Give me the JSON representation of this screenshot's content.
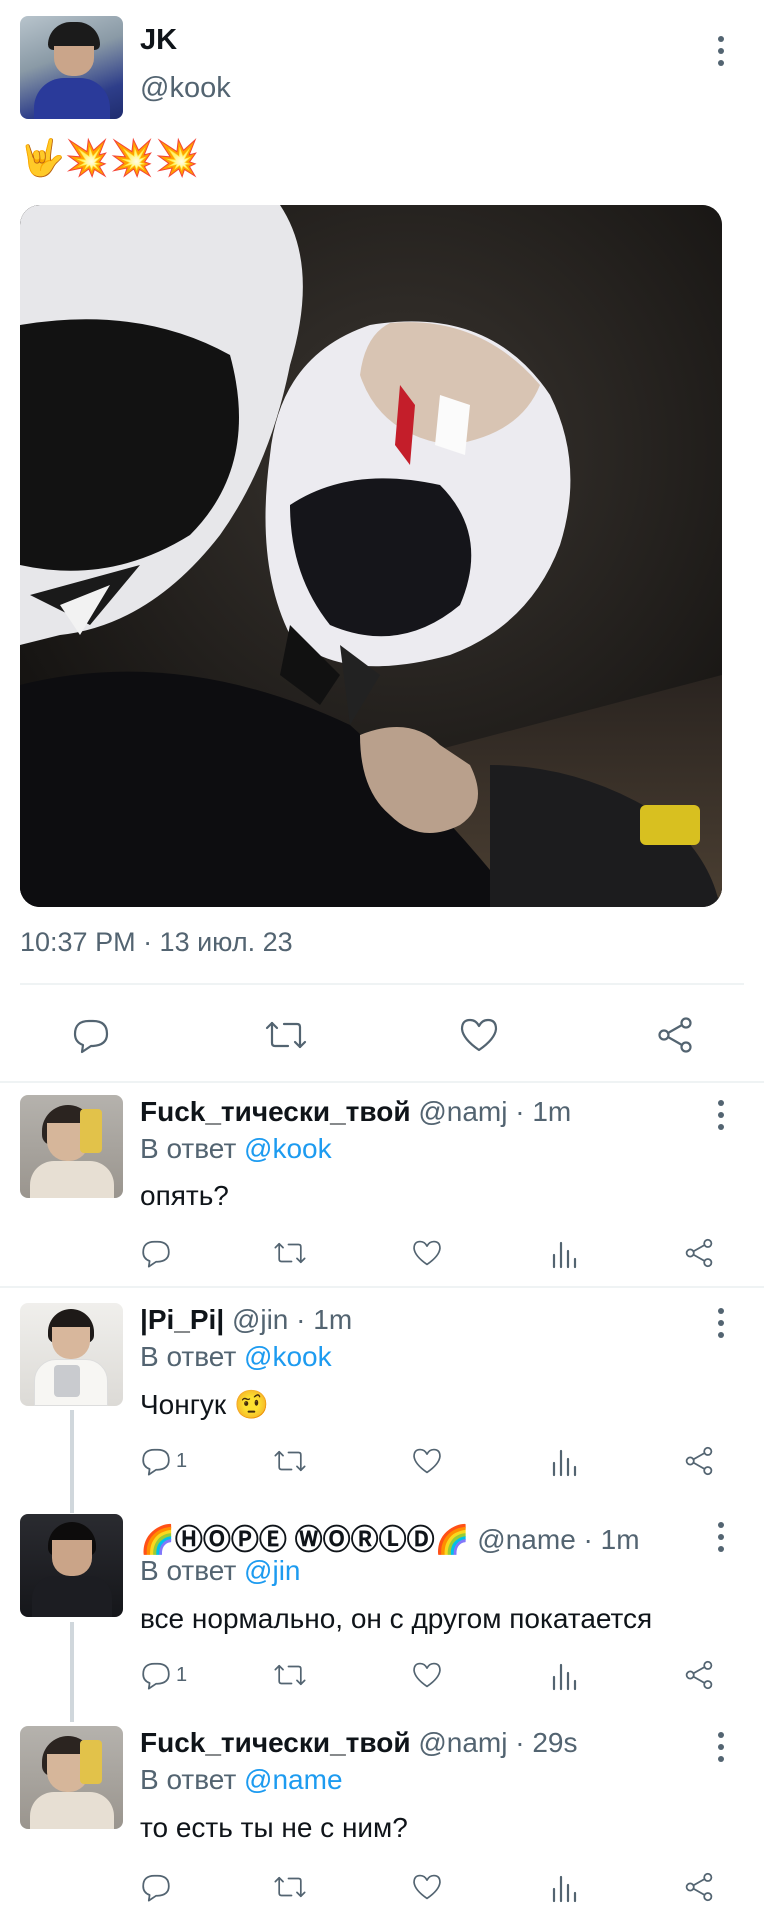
{
  "main_tweet": {
    "author_name": "JK",
    "handle": "@kook",
    "text": "🤟💥💥💥",
    "timestamp": "10:37 PM · 13 июл. 23"
  },
  "reply_prefix": "В ответ",
  "replies": [
    {
      "name": "Fuck_тически_твой",
      "handle": "@namj",
      "time": "· 1m",
      "reply_to": "@kook",
      "text": "опять?",
      "reply_count": ""
    },
    {
      "name": "|Pi_Pi|",
      "handle": "@jin",
      "time": "· 1m",
      "reply_to": "@kook",
      "text": "Чонгук 🤨",
      "reply_count": "1"
    },
    {
      "name": "🌈ⒽⓄⓅⒺ ⓌⓄⓇⓁⒹ🌈",
      "handle": "@name",
      "time": "· 1m",
      "reply_to": "@jin",
      "text": "все нормально,  он с другом покатается",
      "reply_count": "1"
    },
    {
      "name": "Fuck_тически_твой",
      "handle": "@namj",
      "time": "· 29s",
      "reply_to": "@name",
      "text": "то есть ты не с ним?",
      "reply_count": ""
    }
  ],
  "colors": {
    "link": "#1d9bf0",
    "muted": "#536471",
    "text": "#0f1419",
    "divider": "#eff3f4"
  },
  "icons": {
    "reply": "comment-bubble-icon",
    "retweet": "retweet-arrows-icon",
    "like": "heart-icon",
    "views": "bar-chart-icon",
    "share": "share-nodes-icon",
    "more": "vertical-dots-icon"
  }
}
